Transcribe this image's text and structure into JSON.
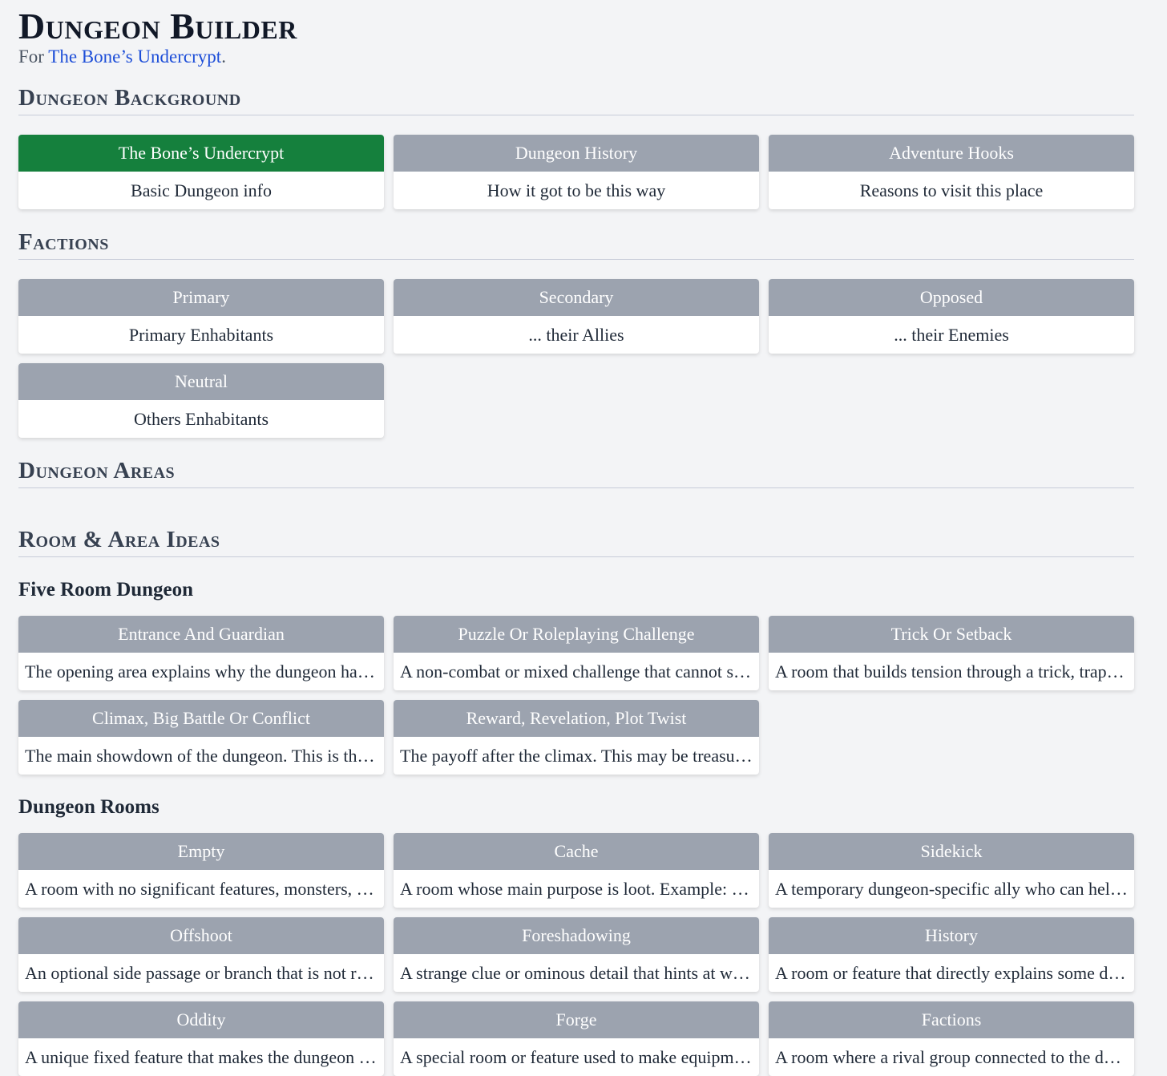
{
  "app": {
    "title": "Dungeon Builder",
    "subtitle_prefix": "For ",
    "dungeon_link": "The Bone’s Undercrypt",
    "subtitle_suffix": "."
  },
  "sections": {
    "background": {
      "title": "Dungeon Background",
      "cards": [
        {
          "head": "The Bone’s Undercrypt",
          "body": "Basic Dungeon info"
        },
        {
          "head": "Dungeon History",
          "body": "How it got to be this way"
        },
        {
          "head": "Adventure Hooks",
          "body": "Reasons to visit this place"
        }
      ]
    },
    "factions": {
      "title": "Factions",
      "cards": [
        {
          "head": "Primary",
          "body": "Primary Enhabitants"
        },
        {
          "head": "Secondary",
          "body": "... their Allies"
        },
        {
          "head": "Opposed",
          "body": "... their Enemies"
        },
        {
          "head": "Neutral",
          "body": "Others Enhabitants"
        }
      ]
    },
    "areas": {
      "title": "Dungeon Areas"
    },
    "ideas": {
      "title": "Room & Area Ideas"
    },
    "five_room": {
      "title": "Five Room Dungeon",
      "cards": [
        {
          "head": "Entrance And Guardian",
          "body": "The opening area explains why the dungeon hasn't been plundered already."
        },
        {
          "head": "Puzzle Or Roleplaying Challenge",
          "body": "A non-combat or mixed challenge that cannot simply be fought through."
        },
        {
          "head": "Trick Or Setback",
          "body": "A room that builds tension through a trick, trap or a setback."
        },
        {
          "head": "Climax, Big Battle Or Conflict",
          "body": "The main showdown of the dungeon. This is the big fight."
        },
        {
          "head": "Reward, Revelation, Plot Twist",
          "body": "The payoff after the climax. This may be treasure or a revelation."
        }
      ]
    },
    "rooms": {
      "title": "Dungeon Rooms",
      "cards": [
        {
          "head": "Empty",
          "body": "A room with no significant features, monsters, or treasure."
        },
        {
          "head": "Cache",
          "body": "A room whose main purpose is loot. Example: a hidden stash."
        },
        {
          "head": "Sidekick",
          "body": "A temporary dungeon-specific ally who can help the party."
        },
        {
          "head": "Offshoot",
          "body": "An optional side passage or branch that is not required."
        },
        {
          "head": "Foreshadowing",
          "body": "A strange clue or ominous detail that hints at what is to come."
        },
        {
          "head": "History",
          "body": "A room or feature that directly explains some dungeon history."
        },
        {
          "head": "Oddity",
          "body": "A unique fixed feature that makes the dungeon memorable."
        },
        {
          "head": "Forge",
          "body": "A special room or feature used to make equipment."
        },
        {
          "head": "Factions",
          "body": "A room where a rival group connected to the dungeon dwells."
        }
      ]
    }
  }
}
